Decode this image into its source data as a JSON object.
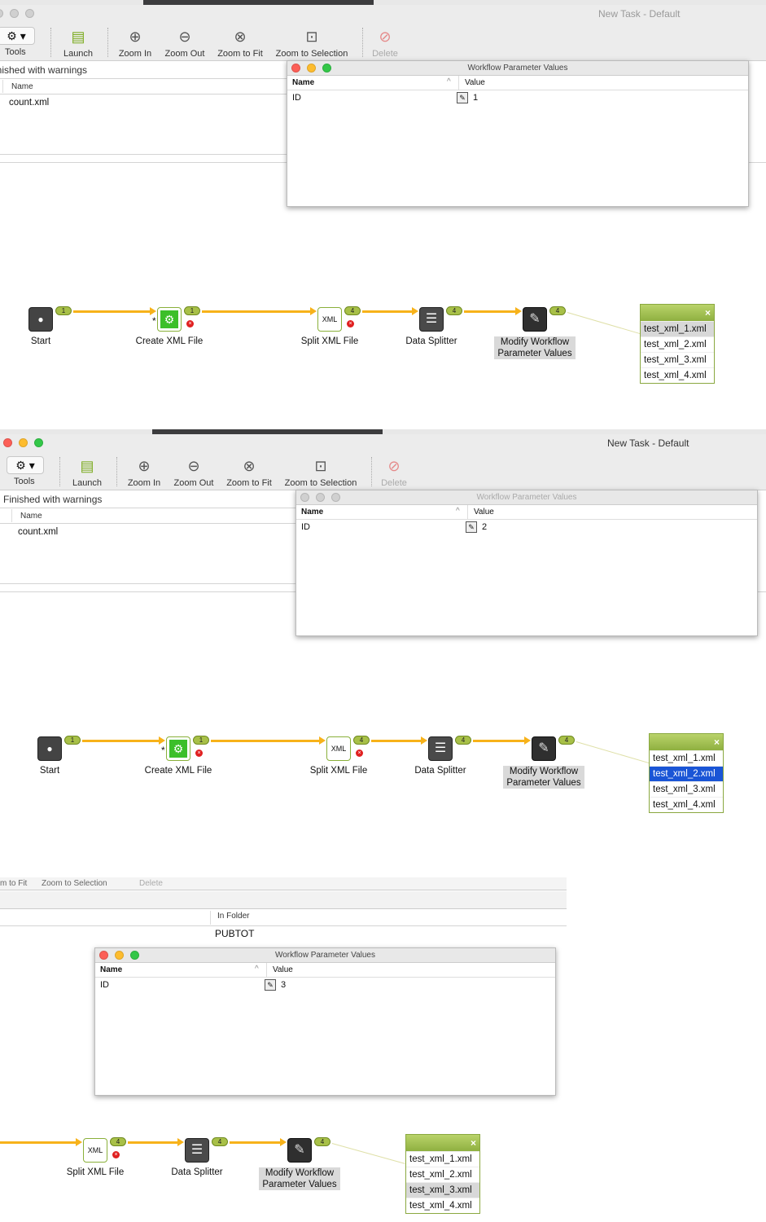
{
  "window_title": "New Task - Default",
  "toolbar": {
    "tools": "Tools",
    "launch": "Launch",
    "zoom_in": "Zoom In",
    "zoom_out": "Zoom Out",
    "zoom_fit": "Zoom to Fit",
    "zoom_selection": "Zoom to Selection",
    "delete": "Delete"
  },
  "status_full": "Finished with warnings",
  "status_cut": "inished with warnings",
  "results_table": {
    "header": "Name",
    "row": "count.xml"
  },
  "dialog": {
    "title": "Workflow Parameter Values",
    "col_name": "Name",
    "col_value": "Value",
    "param": "ID"
  },
  "nodes": {
    "start": "Start",
    "create_xml": "Create XML File",
    "split_xml": "Split XML File",
    "data_splitter": "Data Splitter",
    "modify": "Modify Workflow Parameter Values"
  },
  "files": [
    "test_xml_1.xml",
    "test_xml_2.xml",
    "test_xml_3.xml",
    "test_xml_4.xml"
  ],
  "panels": [
    {
      "id_value": "1",
      "badges": [
        "1",
        "1",
        "4",
        "4",
        "4"
      ],
      "highlighted_file": 0,
      "highlight_style": "gray"
    },
    {
      "id_value": "2",
      "badges": [
        "1",
        "1",
        "4",
        "4",
        "4"
      ],
      "highlighted_file": 1,
      "highlight_style": "blue"
    },
    {
      "id_value": "3",
      "badges": [
        "4",
        "4",
        "4"
      ],
      "highlighted_file": 2,
      "highlight_style": "gray",
      "toolbar_fragment": [
        "m to Fit",
        "Zoom to Selection",
        "Delete"
      ],
      "folder_header": "In Folder",
      "folder_value": "PUBTOT"
    }
  ],
  "colors": {
    "edge": "#f7b21a",
    "badge": "#a8c048",
    "list_header": "#9dbd4a",
    "selection": "#1a55d6"
  }
}
